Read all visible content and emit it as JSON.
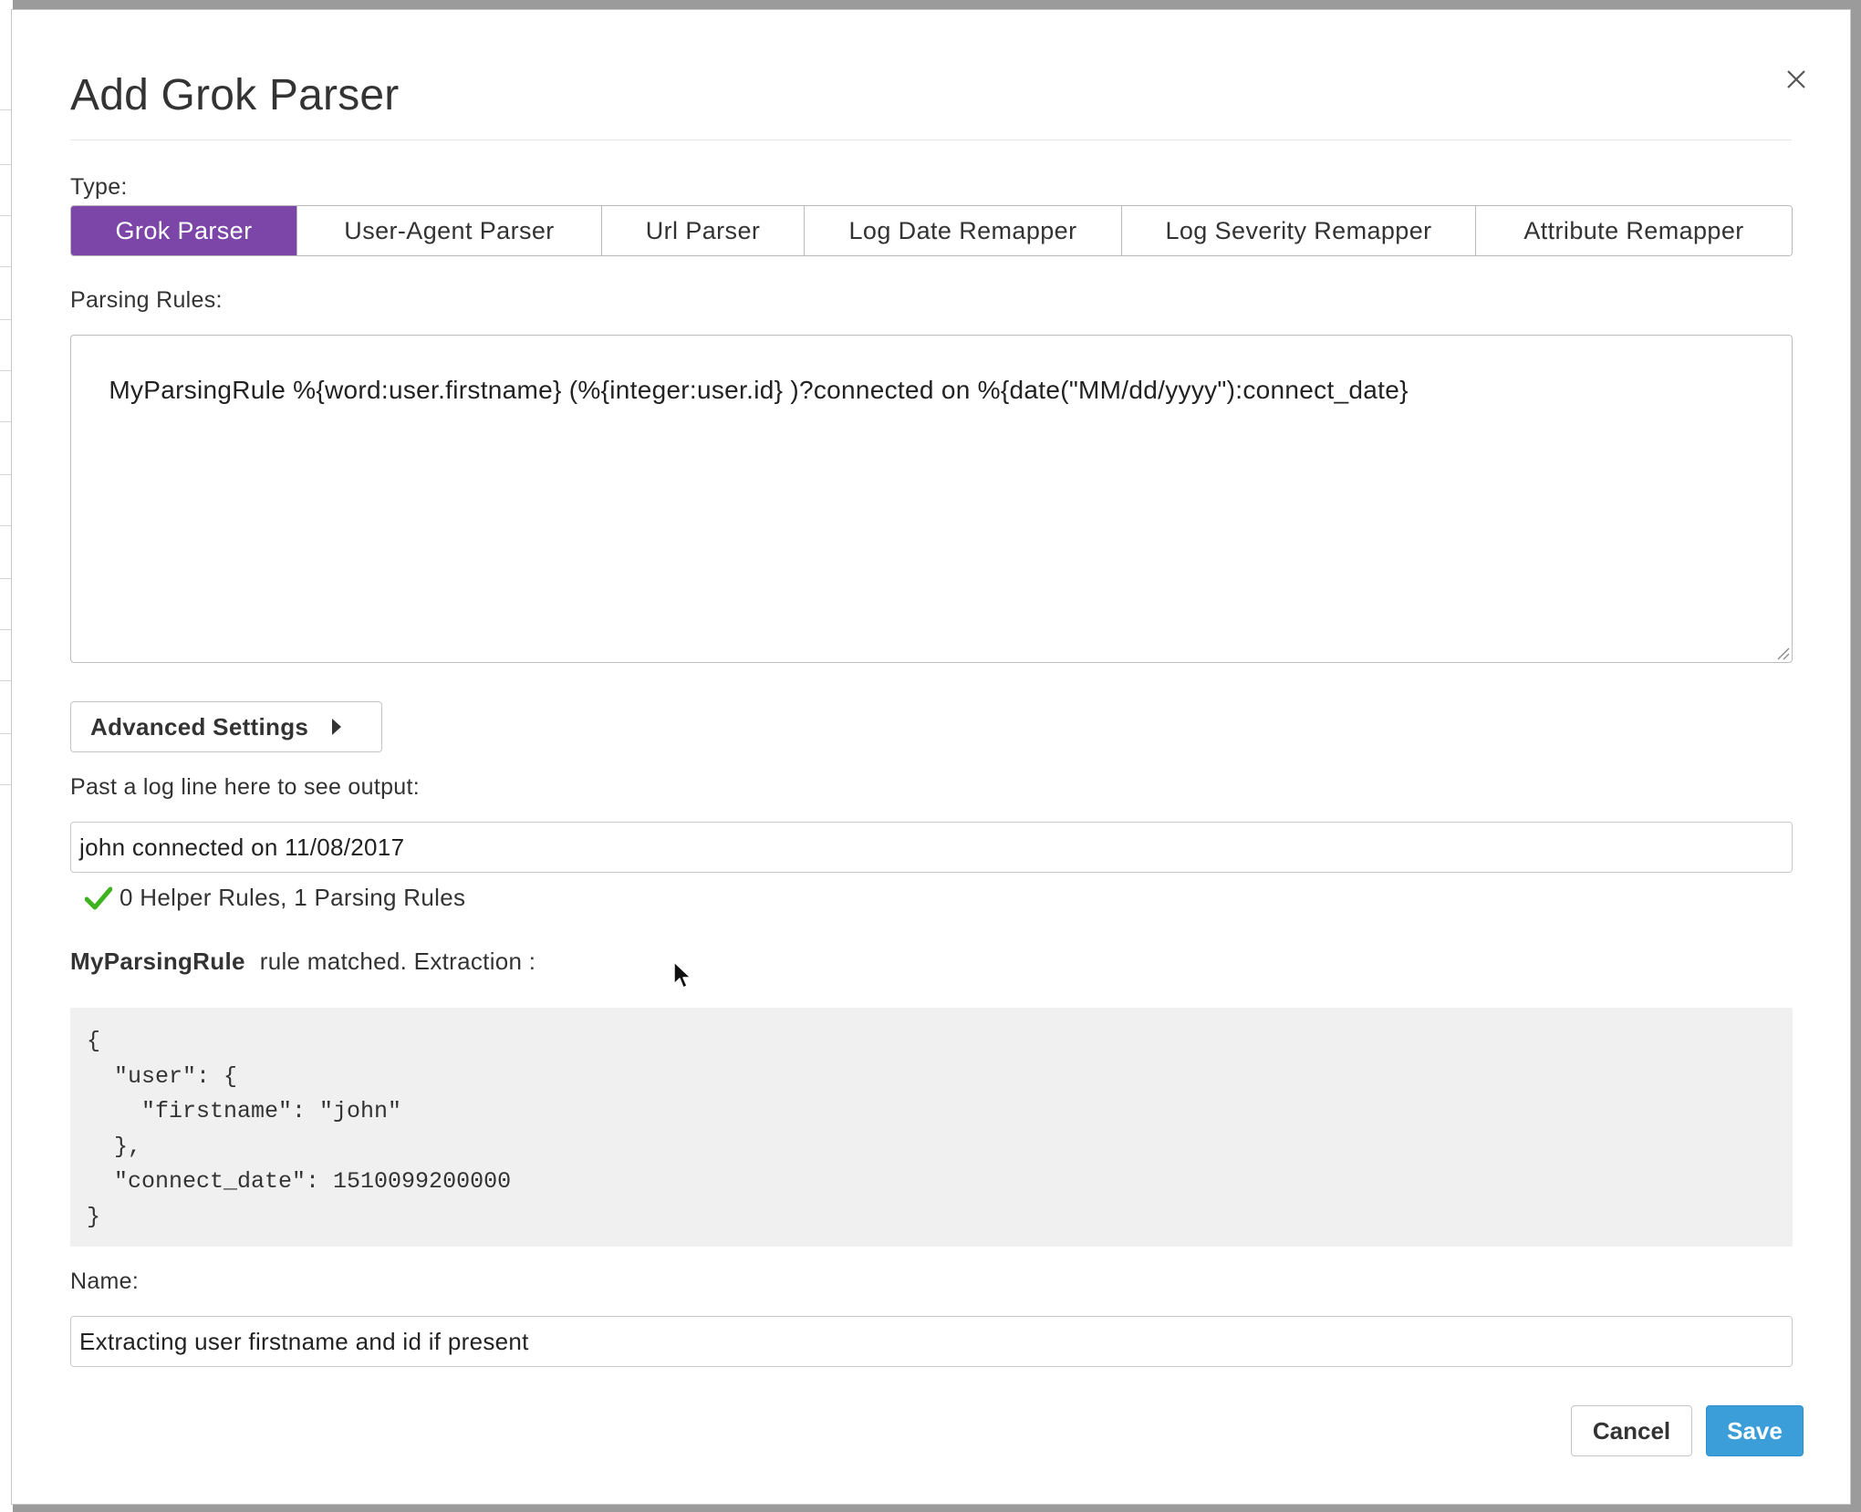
{
  "dialog": {
    "title": "Add Grok Parser"
  },
  "type_section": {
    "label": "Type:",
    "tabs": [
      {
        "label": "Grok Parser",
        "active": true
      },
      {
        "label": "User-Agent Parser",
        "active": false
      },
      {
        "label": "Url Parser",
        "active": false
      },
      {
        "label": "Log Date Remapper",
        "active": false
      },
      {
        "label": "Log Severity Remapper",
        "active": false
      },
      {
        "label": "Attribute Remapper",
        "active": false
      }
    ]
  },
  "parsing_rules": {
    "label": "Parsing Rules:",
    "value": "MyParsingRule %{word:user.firstname} (%{integer:user.id} )?connected on %{date(\"MM/dd/yyyy\"):connect_date}"
  },
  "advanced_settings": {
    "label": "Advanced Settings"
  },
  "log_sample": {
    "label": "Past a log line here to see output:",
    "value": "john connected on 11/08/2017",
    "status": "0 Helper Rules, 1 Parsing Rules"
  },
  "match": {
    "rule_name": "MyParsingRule",
    "text": "rule matched. Extraction :",
    "output": "{\n  \"user\": {\n    \"firstname\": \"john\"\n  },\n  \"connect_date\": 1510099200000\n}"
  },
  "name_section": {
    "label": "Name:",
    "value": "Extracting user firstname and id if present"
  },
  "footer": {
    "cancel_label": "Cancel",
    "save_label": "Save"
  },
  "colors": {
    "accent_purple": "#7c45a8",
    "save_blue": "#3c9ed8",
    "success_green": "#3eb320"
  },
  "icons": {
    "close": "close-icon",
    "check": "check-icon",
    "caret": "caret-right-icon"
  }
}
